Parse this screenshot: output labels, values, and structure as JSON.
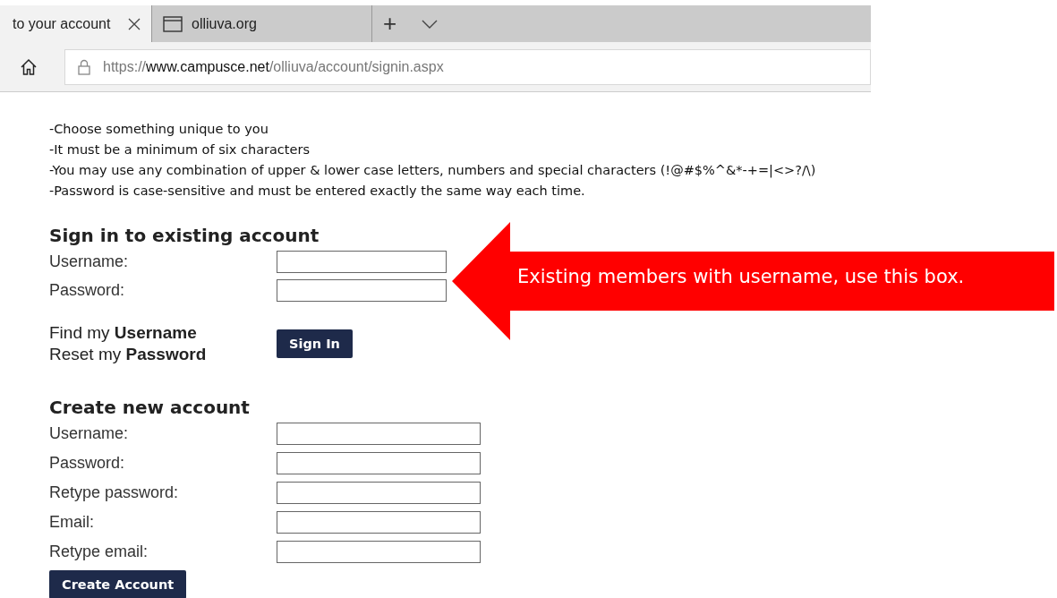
{
  "browser": {
    "tabs": [
      {
        "label": "to your account",
        "selected": true
      },
      {
        "label": "olliuva.org",
        "selected": false
      }
    ],
    "new_tab": "+",
    "url": {
      "scheme": "https://",
      "host": "www.campusce.net",
      "path": "/olliuva/account/signin.aspx"
    }
  },
  "password_rules": [
    "-Choose something unique to you",
    "-It must be a minimum of six characters",
    "-You may use any combination of upper & lower case letters, numbers and special characters (!@#$%^&*-+=|<>?/\\)",
    "-Password is case-sensitive and must be entered exactly the same way each time."
  ],
  "sign_in": {
    "heading": "Sign in to existing account",
    "fields": [
      {
        "label": "Username:"
      },
      {
        "label": "Password:"
      }
    ],
    "links": [
      "Find my **Username**",
      "Reset my **Password**"
    ],
    "button": "Sign In"
  },
  "create": {
    "heading": "Create new account",
    "fields": [
      {
        "label": "Username:"
      },
      {
        "label": "Password:"
      },
      {
        "label": "Retype password:"
      },
      {
        "label": "Email:"
      },
      {
        "label": "Retype email:"
      }
    ],
    "button": "Create Account"
  },
  "callout": "Existing members with username, use this box."
}
